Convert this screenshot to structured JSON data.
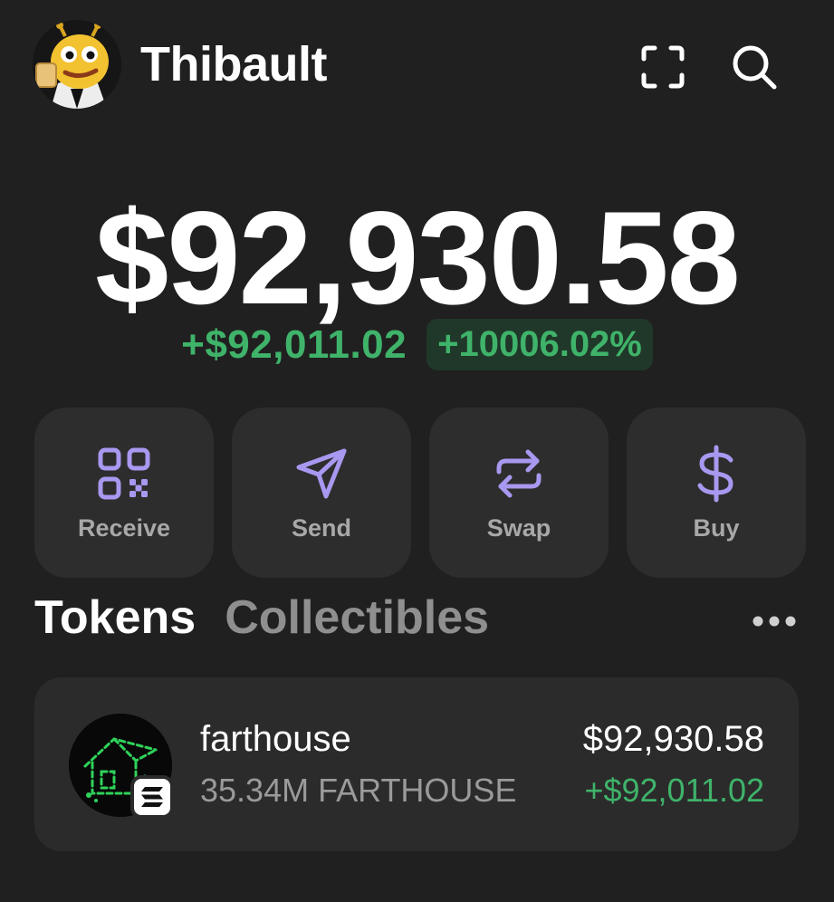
{
  "header": {
    "username": "Thibault",
    "avatar_icon": "pepe-avatar-icon",
    "scan_icon": "scan-icon",
    "search_icon": "search-icon"
  },
  "balance": {
    "total": "$92,930.58",
    "change_abs": "+$92,011.02",
    "change_pct": "+10006.02%"
  },
  "actions": [
    {
      "label": "Receive",
      "icon": "qr-code-icon"
    },
    {
      "label": "Send",
      "icon": "send-icon"
    },
    {
      "label": "Swap",
      "icon": "swap-icon"
    },
    {
      "label": "Buy",
      "icon": "dollar-icon"
    }
  ],
  "tabs": {
    "tokens": "Tokens",
    "collectibles": "Collectibles",
    "more_icon": "more-horizontal-icon"
  },
  "tokens": [
    {
      "name": "farthouse",
      "amount": "35.34M FARTHOUSE",
      "value": "$92,930.58",
      "change": "+$92,011.02",
      "chain_icon": "solana-icon"
    }
  ],
  "colors": {
    "background": "#202020",
    "card": "#2d2d2d",
    "accent": "#a998f0",
    "positive": "#3fb36a",
    "positive_bg": "#203829"
  }
}
